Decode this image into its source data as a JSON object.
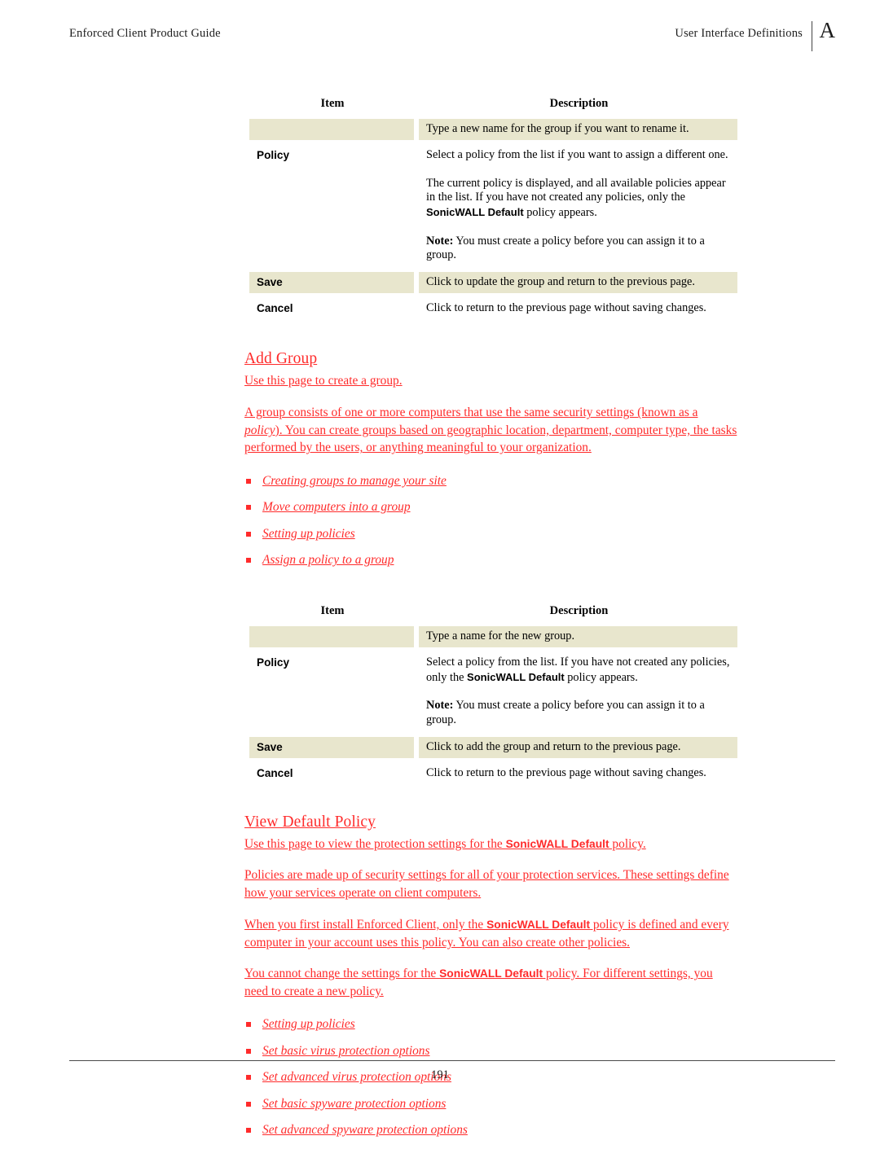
{
  "header": {
    "left_title": "Enforced Client Product Guide",
    "right_title": "User Interface Definitions",
    "appendix_letter": "A"
  },
  "footer": {
    "page_number": "191"
  },
  "colors": {
    "link_red": "#ff2b2b",
    "hatch_red": "#e8122a",
    "highlight_beige": "#e8e6cd",
    "body_black": "#000000"
  },
  "table_edit_group": {
    "columns": [
      "Item",
      "Description"
    ],
    "rows": [
      {
        "item": "",
        "highlight": true,
        "description": "Type a new name for the group if you want to rename it."
      },
      {
        "item": "Policy",
        "highlight": false,
        "description_p1": "Select a policy from the list if you want to assign a different one.",
        "description_p2_a": "The current policy is displayed, and all available policies appear in the list. If you have not created any policies, only the ",
        "description_p2_bold": "SonicWALL Default",
        "description_p2_b": " policy appears.",
        "description_p3_label": "Note:",
        "description_p3_text": " You must create a policy before you can assign it to a group."
      },
      {
        "item": "Save",
        "highlight": true,
        "description": "Click to update the group and return to the previous page."
      },
      {
        "item": "Cancel",
        "highlight": false,
        "description": "Click to return to the previous page without saving changes."
      }
    ]
  },
  "section_add_group": {
    "heading": "Add Group",
    "intro": "Use this page to create a group.",
    "paragraph": "A group consists of one or more computers that use the same security settings (known as a policy). You can create groups based on geographic location, department, computer type, the tasks performed by the users, or anything meaningful to your organization.",
    "paragraph_lead": "A group consists of one or more computers that use the same security settings (known as a ",
    "paragraph_italic": "policy",
    "paragraph_tail": "). You can create groups based on geographic location, department, computer type, the tasks performed by the users, or anything meaningful to your organization.",
    "links": [
      "Creating groups to manage your site",
      "Move computers into a group",
      "Setting up policies",
      "Assign a policy to a group"
    ]
  },
  "table_add_group": {
    "columns": [
      "Item",
      "Description"
    ],
    "rows": [
      {
        "item": "",
        "highlight": true,
        "description": "Type a name for the new group."
      },
      {
        "item": "Policy",
        "highlight": false,
        "description_p1_a": "Select a policy from the list. If you have not created any policies, only the ",
        "description_p1_bold": "SonicWALL Default",
        "description_p1_b": " policy appears.",
        "description_p2_label": "Note:",
        "description_p2_text": " You must create a policy before you can assign it to a group."
      },
      {
        "item": "Save",
        "highlight": true,
        "description": "Click to add the group and return to the previous page."
      },
      {
        "item": "Cancel",
        "highlight": false,
        "description": "Click to return to the previous page without saving changes."
      }
    ]
  },
  "section_view_default_policy": {
    "heading": "View Default Policy",
    "intro_a": "Use this page to view the protection settings for the ",
    "intro_bold": "SonicWALL Default",
    "intro_b": " policy.",
    "paragraph_1": "Policies are made up of security settings for all of your protection services. These settings define how your services operate on client computers.",
    "paragraph_2_a": "When you first install Enforced Client, only the ",
    "paragraph_2_bold": "SonicWALL Default",
    "paragraph_2_b": " policy is defined and every computer in your account uses this policy. You can also create other policies.",
    "paragraph_3_a": "You cannot change the settings for the ",
    "paragraph_3_bold": "SonicWALL Default",
    "paragraph_3_b": " policy. For different settings, you need to create a new policy.",
    "links": [
      "Setting up policies",
      "Set basic virus protection options",
      "Set advanced virus protection options",
      "Set basic spyware protection options",
      "Set advanced spyware protection options"
    ]
  }
}
